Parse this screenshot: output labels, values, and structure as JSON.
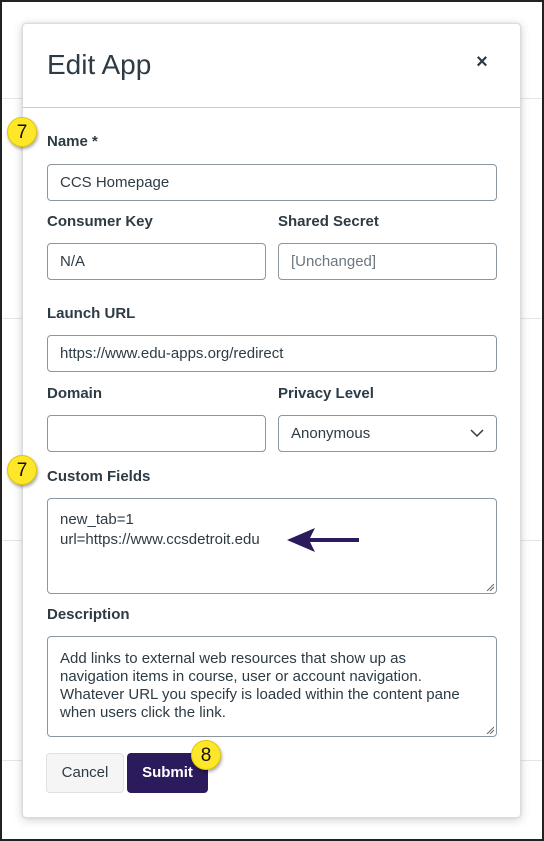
{
  "dialog": {
    "title": "Edit App",
    "close_label": "×"
  },
  "fields": {
    "name": {
      "label": "Name *",
      "value": "CCS Homepage"
    },
    "consumer_key": {
      "label": "Consumer Key",
      "value": "N/A"
    },
    "shared_secret": {
      "label": "Shared Secret",
      "placeholder": "[Unchanged]"
    },
    "launch_url": {
      "label": "Launch URL",
      "value": "https://www.edu-apps.org/redirect"
    },
    "domain": {
      "label": "Domain",
      "value": ""
    },
    "privacy_level": {
      "label": "Privacy Level",
      "selected": "Anonymous"
    },
    "custom_fields": {
      "label": "Custom Fields",
      "lines": [
        "new_tab=1",
        "url=https://www.ccsdetroit.edu"
      ]
    },
    "description": {
      "label": "Description",
      "lines": [
        "Add links to external web resources that show up as",
        "navigation items in course, user or account navigation.",
        "Whatever URL you specify is loaded within the content pane",
        "when users click the link."
      ]
    }
  },
  "buttons": {
    "cancel": "Cancel",
    "submit": "Submit"
  },
  "annotations": {
    "step_badges": [
      "7",
      "7",
      "8"
    ],
    "badge_color": "#fde728",
    "arrow_color": "#2b1a5c",
    "arrow_icon": "arrow-left-icon"
  },
  "colors": {
    "primary_button": "#2b1a5c",
    "text": "#2d3b45",
    "border": "#8b969e"
  }
}
